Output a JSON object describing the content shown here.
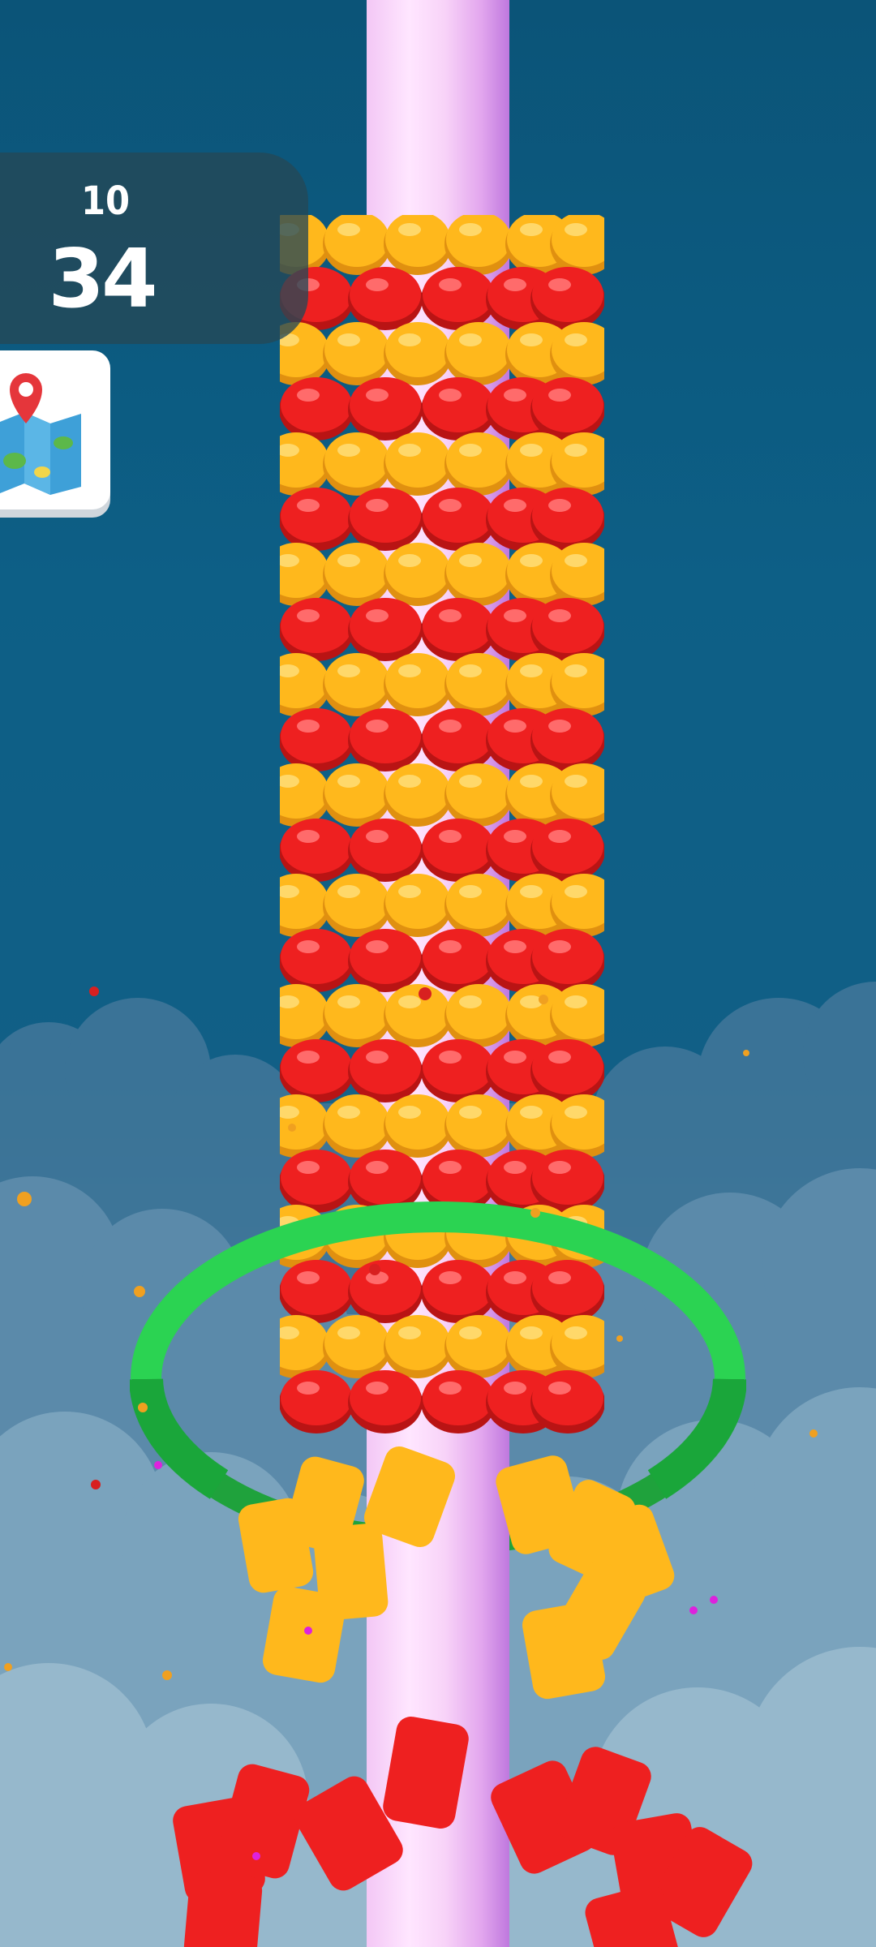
{
  "hud": {
    "level": "10",
    "score": "34"
  },
  "buttons": {
    "map": {
      "icon": "map-pin-icon"
    }
  },
  "colors": {
    "background_top": "#0b5478",
    "pole": "#f8d3f8",
    "corn_yellow": "#ffb81c",
    "corn_red": "#ee2020",
    "ring_green": "#22cc44"
  }
}
